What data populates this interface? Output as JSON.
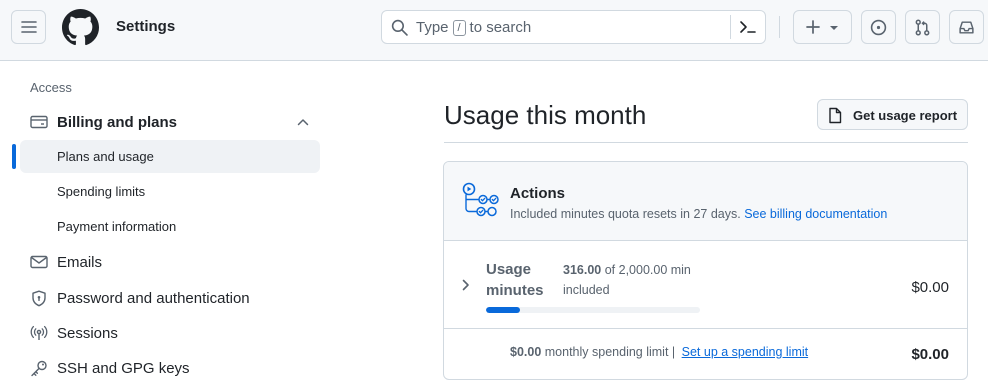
{
  "header": {
    "title": "Settings",
    "search": {
      "placeholder_prefix": "Type",
      "placeholder_key": "/",
      "placeholder_suffix": "to search"
    }
  },
  "sidebar": {
    "heading": "Access",
    "billing": {
      "label": "Billing and plans",
      "items": [
        {
          "label": "Plans and usage",
          "active": true
        },
        {
          "label": "Spending limits"
        },
        {
          "label": "Payment information"
        }
      ]
    },
    "items": [
      {
        "label": "Emails",
        "icon": "mail-icon"
      },
      {
        "label": "Password and authentication",
        "icon": "shield-icon"
      },
      {
        "label": "Sessions",
        "icon": "broadcast-icon"
      },
      {
        "label": "SSH and GPG keys",
        "icon": "key-icon"
      }
    ]
  },
  "main": {
    "title": "Usage this month",
    "report_button": "Get usage report",
    "actions": {
      "title": "Actions",
      "subtitle": "Included minutes quota resets in 27 days.",
      "doc_link": "See billing documentation",
      "usage": {
        "name_line1": "Usage",
        "name_line2": "minutes",
        "used": "316.00",
        "of_total": "of 2,000.00 min",
        "included": "included",
        "fraction": 0.158,
        "amount": "$0.00"
      },
      "limit": {
        "value": "$0.00",
        "text": "monthly spending limit |",
        "link": "Set up a spending limit",
        "amount": "$0.00"
      }
    }
  },
  "colors": {
    "accent": "#0969da",
    "border": "#d1d9e0",
    "muted": "#59636e"
  }
}
